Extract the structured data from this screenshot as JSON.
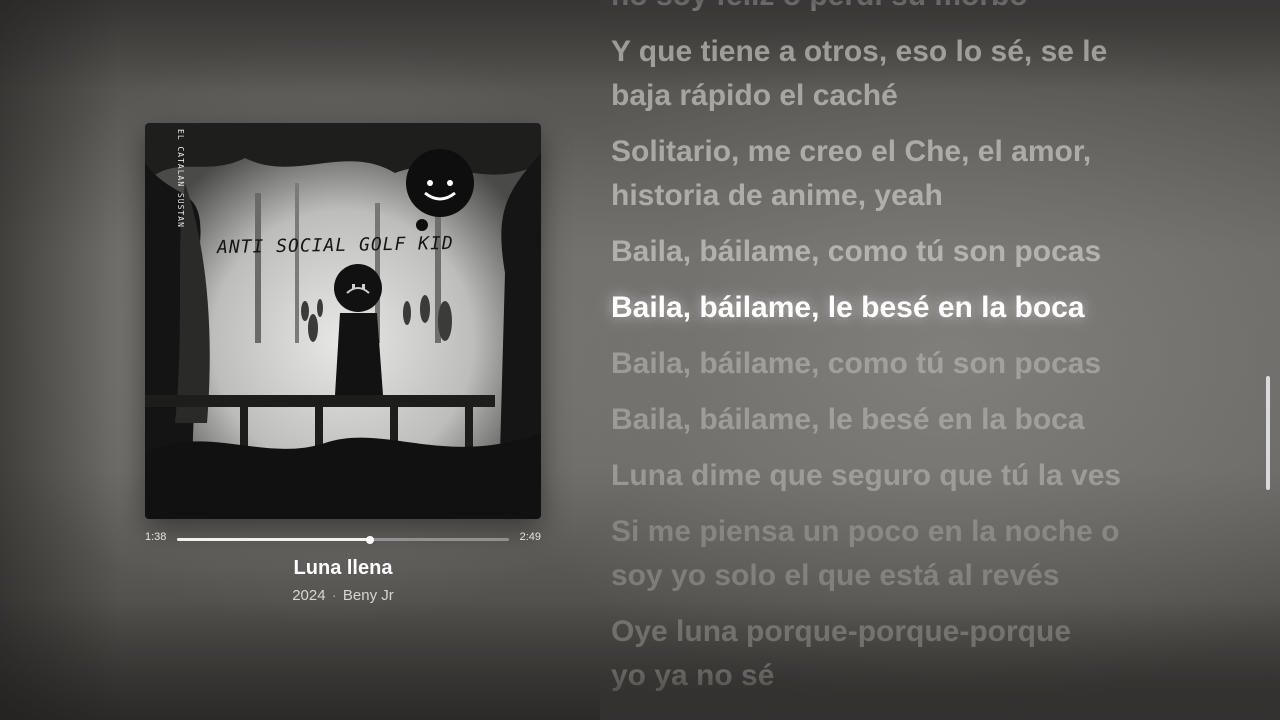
{
  "player": {
    "artwork": {
      "title_text": "ANTI SOCIAL GOLF KID",
      "side_text": "EL CATALAN SUSTAN"
    },
    "progress": {
      "elapsed": "1:38",
      "total": "2:49",
      "fraction": 0.58
    },
    "song": {
      "title": "Luna llena",
      "year": "2024",
      "separator": "·",
      "artist": "Beny Jr"
    }
  },
  "lyrics": {
    "lines": [
      "no soy feliz o perdí su morbo",
      "Y que tiene a otros, eso lo sé, se le",
      "baja rápido el caché",
      "Solitario, me creo el Che, el amor,",
      "historia de anime, yeah",
      "Baila, báilame, como tú son pocas",
      "Baila, báilame, le besé en la boca",
      "Baila, báilame, como tú son pocas",
      "Baila, báilame, le besé en la boca",
      "Luna dime que seguro que tú la ves",
      "Si me piensa un poco en la noche o",
      "soy yo solo el que está al revés",
      "Oye luna porque-porque-porque",
      "yo ya no sé"
    ],
    "active_index": 6
  },
  "colors": {
    "active_lyric": "#ffffff",
    "inactive_lyric": "#e1dfdb",
    "track": "#f2f1ee"
  }
}
